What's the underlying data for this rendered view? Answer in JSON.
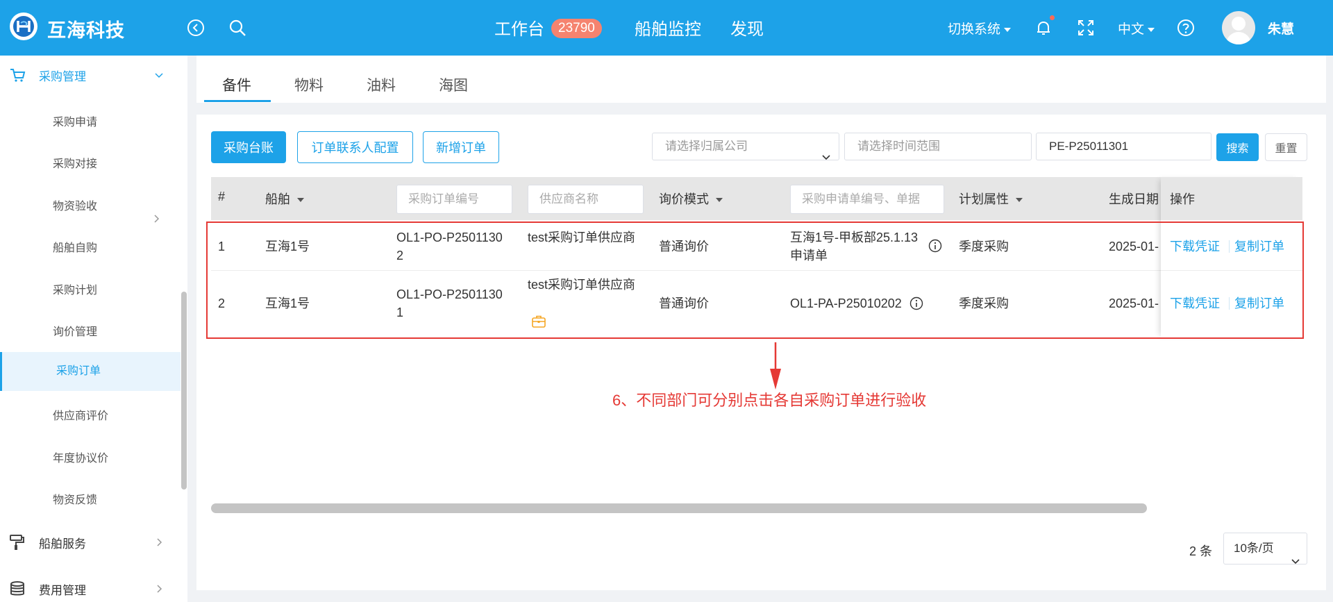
{
  "header": {
    "brand": "互海科技",
    "nav_workbench": "工作台",
    "workbench_badge": "23790",
    "nav_ship_monitor": "船舶监控",
    "nav_discover": "发现",
    "switch_system": "切换系统",
    "language": "中文",
    "username": "朱慧"
  },
  "sidebar": {
    "group_purchase": "采购管理",
    "items": [
      "采购申请",
      "采购对接",
      "物资验收",
      "船舶自购",
      "采购计划",
      "询价管理",
      "采购订单",
      "供应商评价",
      "年度协议价",
      "物资反馈"
    ],
    "group_ship_service": "船舶服务",
    "group_expense": "费用管理"
  },
  "tabs": [
    "备件",
    "物料",
    "油料",
    "海图"
  ],
  "toolbar": {
    "btn_ledger": "采购台账",
    "btn_contact_config": "订单联系人配置",
    "btn_new_order": "新增订单",
    "company_placeholder": "请选择归属公司",
    "time_placeholder": "请选择时间范围",
    "search_value": "PE-P25011301",
    "btn_search": "搜索",
    "btn_reset": "重置"
  },
  "table": {
    "headers": {
      "index": "#",
      "ship": "船舶",
      "order_no_placeholder": "采购订单编号",
      "supplier_placeholder": "供应商名称",
      "inquiry_mode": "询价模式",
      "request_placeholder": "采购申请单编号、单据",
      "plan_attr": "计划属性",
      "created_date": "生成日期",
      "actions": "操作"
    },
    "rows": [
      {
        "index": "1",
        "ship": "互海1号",
        "order_no_line1": "OL1-PO-P2501130",
        "order_no_line2": "2",
        "supplier": "test采购订单供应商",
        "inquiry_mode": "普通询价",
        "request_line1": "互海1号-甲板部25.1.13",
        "request_line2": "申请单",
        "plan_attr": "季度采购",
        "created_date": "2025-01-",
        "action_download": "下载凭证",
        "action_copy": "复制订单"
      },
      {
        "index": "2",
        "ship": "互海1号",
        "order_no_line1": "OL1-PO-P2501130",
        "order_no_line2": "1",
        "supplier": "test采购订单供应商",
        "inquiry_mode": "普通询价",
        "request_line1": "OL1-PA-P25010202",
        "request_line2": "",
        "plan_attr": "季度采购",
        "created_date": "2025-01-",
        "action_download": "下载凭证",
        "action_copy": "复制订单"
      }
    ]
  },
  "annotation": "6、不同部门可分别点击各自采购订单进行验收",
  "pagination": {
    "count": "2 条",
    "page_size": "10条/页"
  },
  "colors": {
    "primary": "#1da2e8",
    "badge": "#f5836f",
    "annotation": "#e53935"
  }
}
